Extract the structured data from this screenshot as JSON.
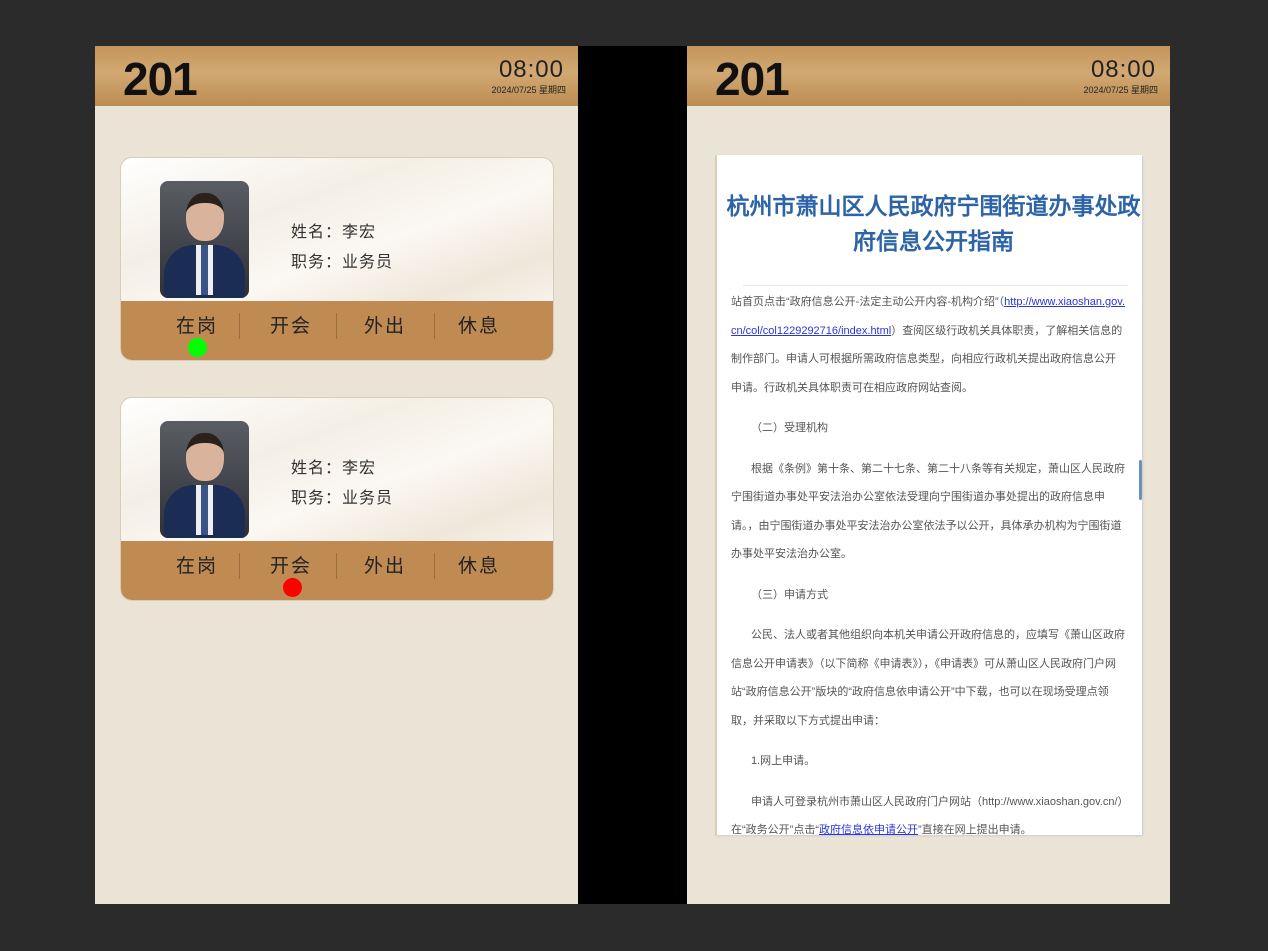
{
  "screens": [
    {
      "room": "201",
      "time": "08:00",
      "date": "2024/07/25  星期四"
    },
    {
      "room": "201",
      "time": "08:00",
      "date": "2024/07/25  星期四"
    }
  ],
  "cards": [
    {
      "name_label": "姓名：",
      "name": "李宏",
      "role_label": "职务：",
      "role": "业务员",
      "statuses": [
        "在岗",
        "开会",
        "外出",
        "休息"
      ],
      "active_index": 0,
      "indicator_color": "#00ff00"
    },
    {
      "name_label": "姓名：",
      "name": "李宏",
      "role_label": "职务：",
      "role": "业务员",
      "statuses": [
        "在岗",
        "开会",
        "外出",
        "休息"
      ],
      "active_index": 1,
      "indicator_color": "#ff0000"
    }
  ],
  "doc": {
    "title": "杭州市萧山区人民政府宁围街道办事处政府信息公开指南",
    "p1_a": "站首页点击“政府信息公开-法定主动公开内容-机构介绍”（",
    "p1_link": "http://www.xiaoshan.gov.cn/col/col1229292716/index.html",
    "p1_b": "）查阅区级行政机关具体职责，了解相关信息的制作部门。申请人可根据所需政府信息类型，向相应行政机关提出政府信息公开申请。行政机关具体职责可在相应政府网站查阅。",
    "h2": "（二）受理机构",
    "p2": "根据《条例》第十条、第二十七条、第二十八条等有关规定，萧山区人民政府宁围街道办事处平安法治办公室依法受理向宁围街道办事处提出的政府信息申请。，由宁围街道办事处平安法治办公室依法予以公开，具体承办机构为宁围街道办事处平安法治办公室。",
    "h3": "（三）申请方式",
    "p3": "公民、法人或者其他组织向本机关申请公开政府信息的，应填写《萧山区政府信息公开申请表》（以下简称《申请表》），《申请表》可从萧山区人民政府门户网站“政府信息公开”版块的“政府信息依申请公开”中下载，也可以在现场受理点领取，并采取以下方式提出申请：",
    "h4": "1.网上申请。",
    "p4_a": "申请人可登录杭州市萧山区人民政府门户网站（http://www.xiaoshan.gov.cn/）在“政务公开”点击“",
    "p4_link": "政府信息依申请公开",
    "p4_b": "”直接在网上提出申请。"
  },
  "colors": {
    "header": "#c4955c",
    "panel": "#ebe4d6",
    "status_bar": "#bf8b53",
    "title": "#2d64a8"
  }
}
